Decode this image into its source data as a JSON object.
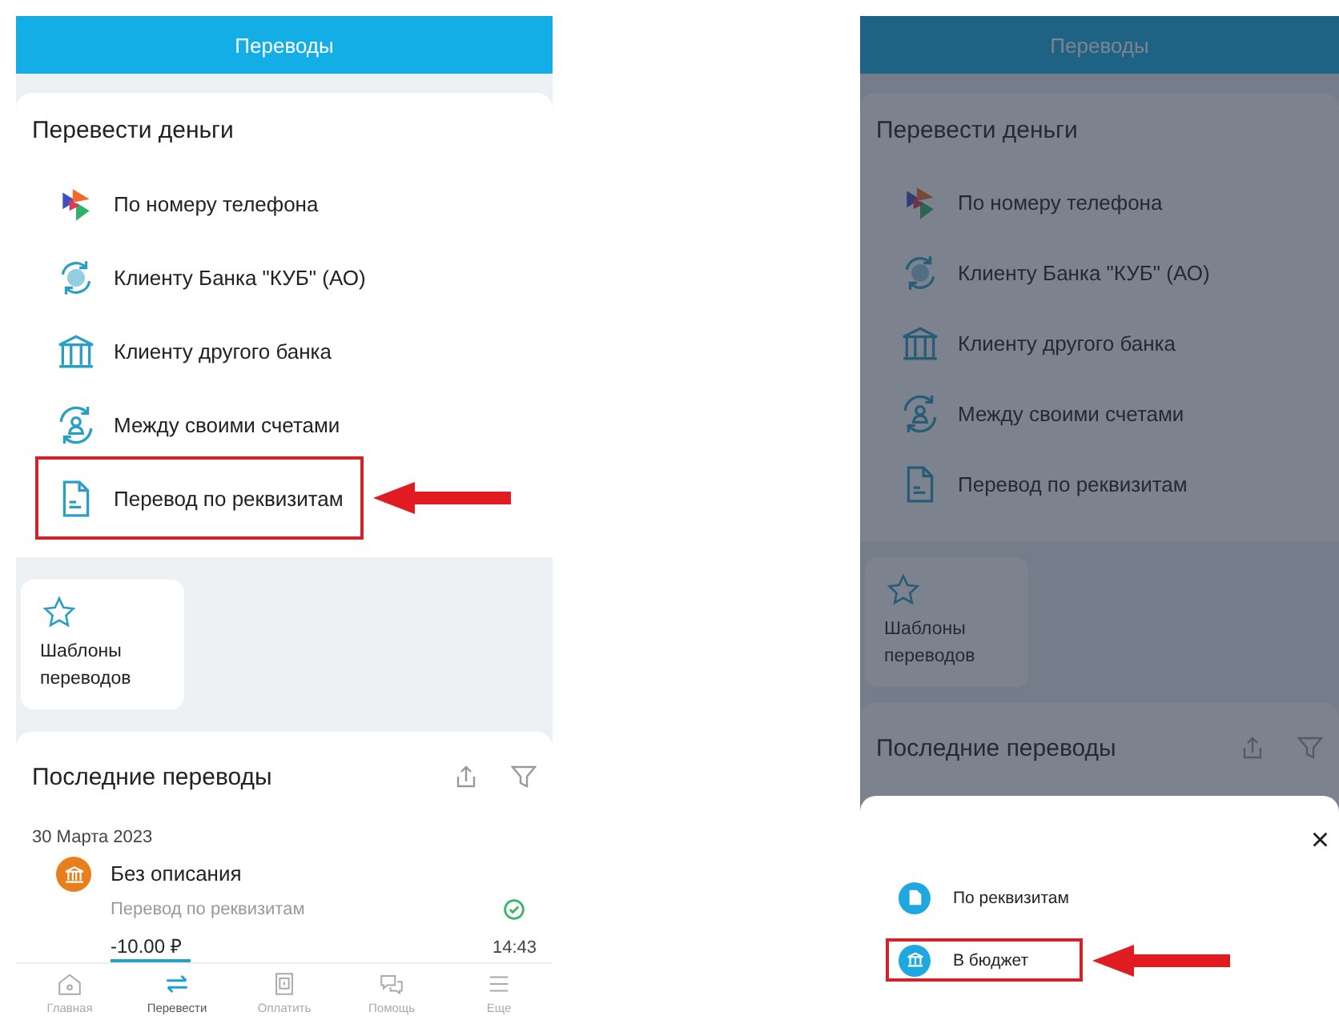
{
  "screens": [
    {
      "header_title": "Переводы",
      "dimmed": false,
      "transfer": {
        "title": "Перевести деньги",
        "items": [
          {
            "label": "По номеру телефона",
            "highlighted": false
          },
          {
            "label": "Клиенту Банка \"КУБ\" (АО)",
            "highlighted": false
          },
          {
            "label": "Клиенту другого банка",
            "highlighted": false
          },
          {
            "label": "Между своими счетами",
            "highlighted": false
          },
          {
            "label": "Перевод по реквизитам",
            "highlighted": true
          }
        ]
      },
      "templates": {
        "label": "Шаблоны переводов"
      },
      "recent": {
        "title": "Последние переводы",
        "date": "30 Марта 2023",
        "transactions": [
          {
            "title": "Без описания",
            "subtitle": "Перевод по реквизитам",
            "amount": "-10.00 ₽",
            "time": "14:43",
            "done": true
          }
        ]
      },
      "tab_bar": [
        {
          "label": "Главная",
          "selected": false
        },
        {
          "label": "Перевести",
          "selected": true
        },
        {
          "label": "Оплатить",
          "selected": false
        },
        {
          "label": "Помощь",
          "selected": false
        },
        {
          "label": "Еще",
          "selected": false
        }
      ]
    },
    {
      "header_title": "Переводы",
      "dimmed": true,
      "transfer": {
        "title": "Перевести деньги",
        "items": [
          {
            "label": "По номеру телефона",
            "highlighted": false
          },
          {
            "label": "Клиенту Банка \"КУБ\" (АО)",
            "highlighted": false
          },
          {
            "label": "Клиенту другого банка",
            "highlighted": false
          },
          {
            "label": "Между своими счетами",
            "highlighted": false
          },
          {
            "label": "Перевод по реквизитам",
            "highlighted": false
          }
        ]
      },
      "templates": {
        "label": "Шаблоны переводов"
      },
      "recent": {
        "title": "Последние переводы"
      },
      "sheet": {
        "close": "×",
        "items": [
          {
            "label": "По реквизитам",
            "highlighted": false
          },
          {
            "label": "В бюджет",
            "highlighted": true
          }
        ]
      }
    }
  ]
}
